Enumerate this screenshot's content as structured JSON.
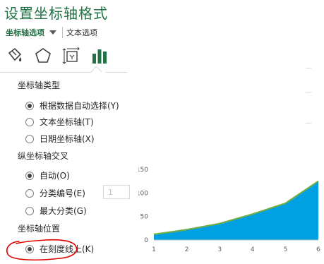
{
  "panel": {
    "title": "设置坐标轴格式",
    "tabs": {
      "active": "坐标轴选项",
      "other": "文本选项"
    },
    "icons": [
      "fill-line-icon",
      "effects-icon",
      "size-properties-icon",
      "axis-options-icon"
    ]
  },
  "axis_type": {
    "heading": "坐标轴类型",
    "options": [
      {
        "label": "根据数据自动选择(Y)",
        "checked": true
      },
      {
        "label": "文本坐标轴(T)",
        "checked": false
      },
      {
        "label": "日期坐标轴(X)",
        "checked": false
      }
    ]
  },
  "cross": {
    "heading": "纵坐标轴交叉",
    "options": [
      {
        "label": "自动(O)",
        "checked": true
      },
      {
        "label": "分类编号(E)",
        "checked": false
      },
      {
        "label": "最大分类(G)",
        "checked": false
      }
    ],
    "category_number_value": "1"
  },
  "position": {
    "heading": "坐标轴位置",
    "options": [
      {
        "label": "在刻度线上(K)",
        "checked": true
      }
    ]
  },
  "colors": {
    "accent": "#217346",
    "area_fill": "#00a0e3",
    "area_line": "#70ad47",
    "annotation": "#e00000"
  },
  "chart_data": {
    "type": "area",
    "x": [
      1,
      2,
      3,
      4,
      5,
      6
    ],
    "values": [
      12,
      22,
      35,
      55,
      78,
      125
    ],
    "ylim": [
      0,
      150
    ],
    "yticks": [
      0,
      50,
      100,
      150
    ],
    "xticks": [
      1,
      2,
      3,
      4,
      5,
      6
    ],
    "tick_labels_y": [
      "0",
      "50",
      "100",
      "150"
    ],
    "tick_labels_x": [
      "1",
      "2",
      "3",
      "4",
      "5",
      "6"
    ],
    "grid": false,
    "title": "",
    "xlabel": "",
    "ylabel": ""
  }
}
